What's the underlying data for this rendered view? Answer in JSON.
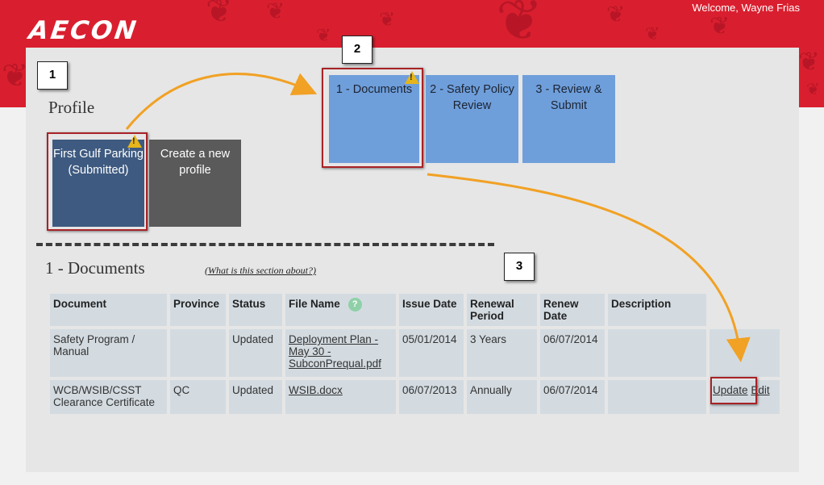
{
  "header": {
    "logo": "AECON",
    "welcome": "Welcome, Wayne Frias"
  },
  "callouts": [
    "1",
    "2",
    "3"
  ],
  "profile": {
    "heading": "Profile",
    "tiles": [
      {
        "label": "First Gulf Parking (Submitted)",
        "warning": true
      },
      {
        "label": "Create a new profile",
        "warning": false
      }
    ]
  },
  "steps": [
    {
      "label": "1 - Documents",
      "warning": true
    },
    {
      "label": "2 - Safety Policy Review",
      "warning": false
    },
    {
      "label": "3 - Review & Submit",
      "warning": false
    }
  ],
  "documents": {
    "heading": "1 - Documents",
    "help_link": "(What is this section about?)",
    "columns": [
      "Document",
      "Province",
      "Status",
      "File Name",
      "Issue Date",
      "Renewal Period",
      "Renew Date",
      "Description"
    ],
    "help_icon": "?",
    "rows": [
      {
        "document": "Safety Program / Manual",
        "province": "",
        "status": "Updated",
        "file_name": "Deployment Plan - May 30 - SubconPrequal.pdf",
        "issue_date": "05/01/2014",
        "renewal_period": "3 Years",
        "renew_date": "06/07/2014",
        "description": "",
        "actions": []
      },
      {
        "document": "WCB/WSIB/CSST Clearance Certificate",
        "province": "QC",
        "status": "Updated",
        "file_name": "WSIB.docx",
        "issue_date": "06/07/2013",
        "renewal_period": "Annually",
        "renew_date": "06/07/2014",
        "description": "",
        "actions": [
          "Update",
          "Edit"
        ]
      }
    ]
  },
  "colors": {
    "banner": "#d91f2f",
    "profile_tile": "#3e5a80",
    "new_tile": "#5a5a5a",
    "step_tile": "#6f9fdb",
    "highlight": "#a82226",
    "arrow": "#f1a124",
    "warning": "#e6b51b"
  },
  "icons": {
    "banner_decoration": "maple-leaf-icon",
    "warning": "warning-icon",
    "help": "help-icon"
  }
}
